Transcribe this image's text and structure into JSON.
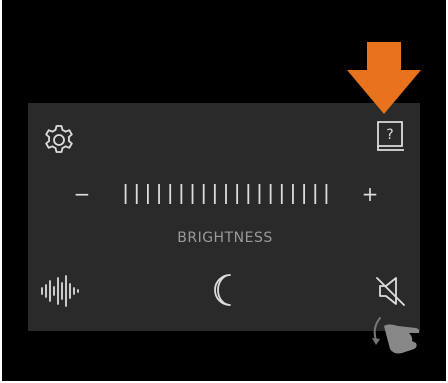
{
  "panel": {
    "brightness_label": "BRIGHTNESS",
    "decrease_label": "−",
    "increase_label": "+",
    "brightness_level": 1.0,
    "tick_count": 19
  },
  "help_icon_text": "?",
  "colors": {
    "background": "#000000",
    "panel": "#2a2a2a",
    "icon": "#dcdcdc",
    "label": "#9a9a9a",
    "arrow": "#e8731c"
  },
  "icons": {
    "settings": "gear-icon",
    "help": "help-book-icon",
    "sound": "sound-wave-icon",
    "night": "moon-icon",
    "mute": "speaker-muted-icon",
    "gesture": "hand-swipe-icon",
    "pointer": "orange-arrow-down-icon"
  }
}
